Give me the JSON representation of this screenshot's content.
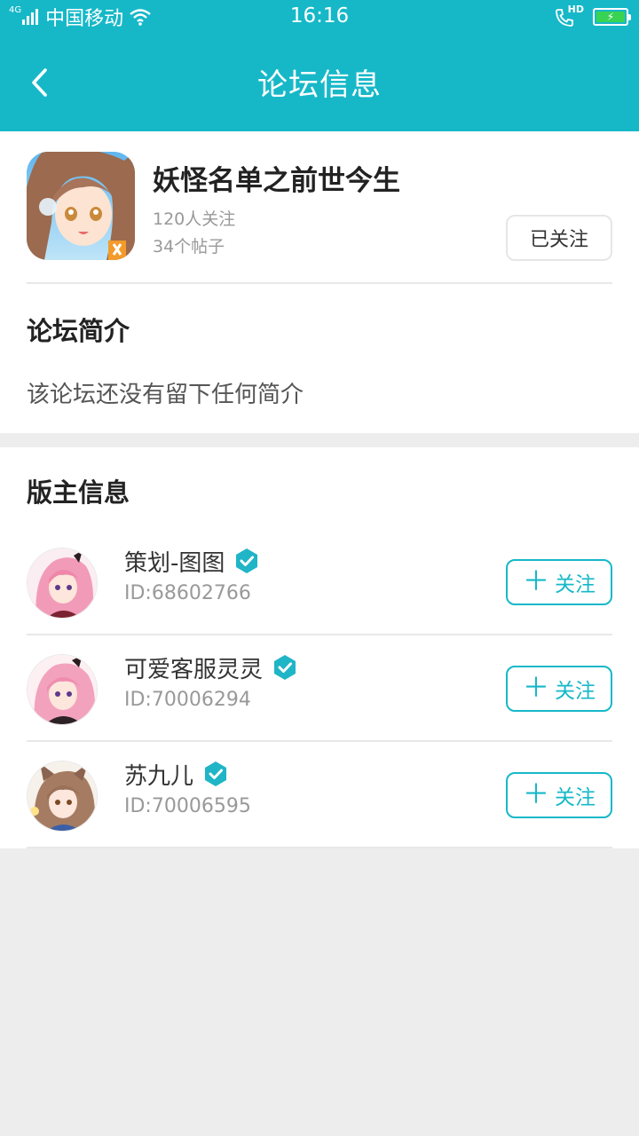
{
  "status_bar": {
    "network": "4G",
    "carrier": "中国移动",
    "time": "16:16",
    "call_badge": "HD"
  },
  "nav": {
    "title": "论坛信息",
    "back_icon": "chevron-left-icon"
  },
  "forum": {
    "name": "妖怪名单之前世今生",
    "followers": "120人关注",
    "posts": "34个帖子",
    "follow_state_label": "已关注",
    "intro_heading": "论坛简介",
    "intro_text": "该论坛还没有留下任何简介"
  },
  "moderators": {
    "heading": "版主信息",
    "follow_label": "关注",
    "items": [
      {
        "name": "策划-图图",
        "id": "ID:68602766",
        "verified": true
      },
      {
        "name": "可爱客服灵灵",
        "id": "ID:70006294",
        "verified": true
      },
      {
        "name": "苏九儿",
        "id": "ID:70006595",
        "verified": true
      }
    ]
  },
  "colors": {
    "accent": "#16b8c8",
    "background": "#ededed",
    "verified": "#1fb5c7"
  }
}
